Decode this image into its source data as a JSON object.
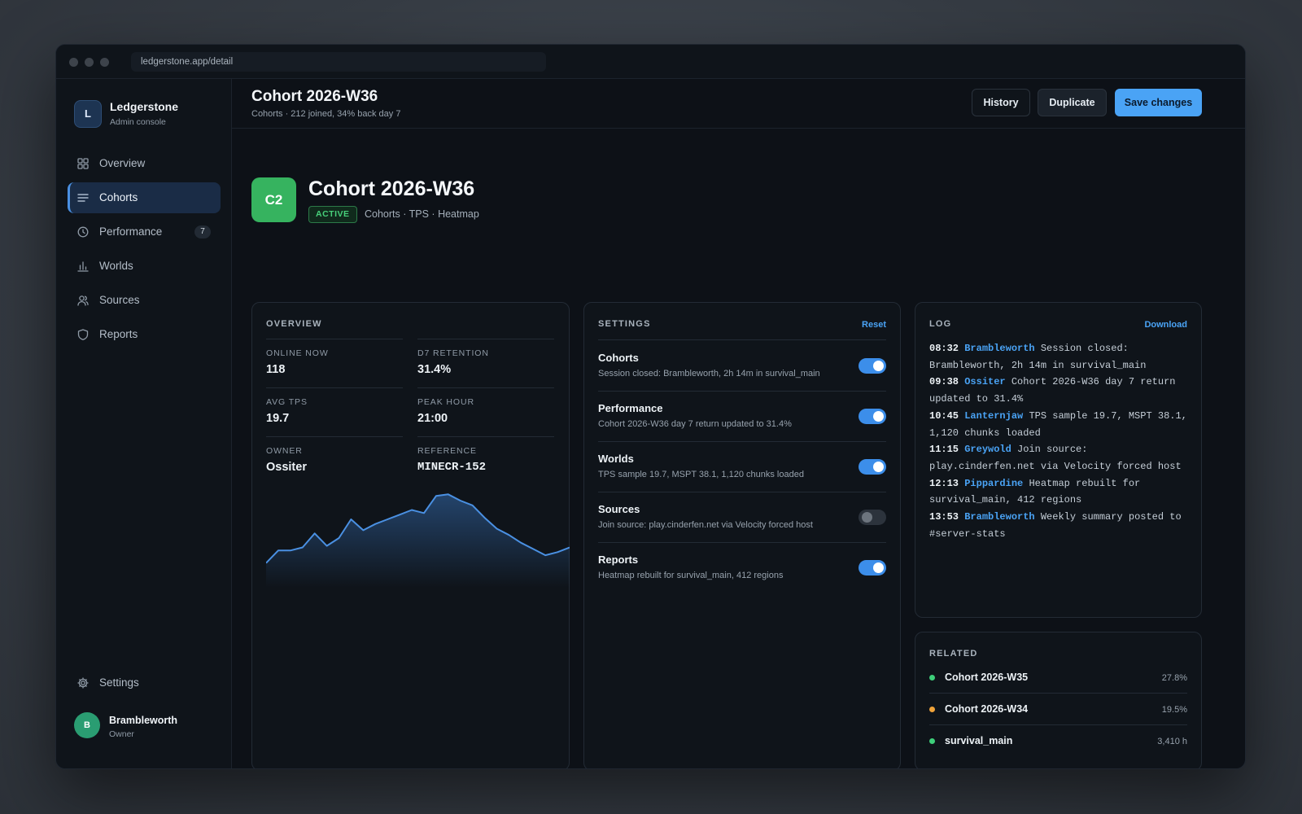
{
  "browser": {
    "url": "ledgerstone.app/detail"
  },
  "brand": {
    "logo_letter": "L",
    "name": "Ledgerstone",
    "subtitle": "Admin console"
  },
  "nav": {
    "items": [
      {
        "label": "Overview",
        "icon": "grid-icon"
      },
      {
        "label": "Cohorts",
        "icon": "list-icon",
        "active": true
      },
      {
        "label": "Performance",
        "icon": "clock-icon",
        "badge": "7"
      },
      {
        "label": "Worlds",
        "icon": "bar-chart-icon"
      },
      {
        "label": "Sources",
        "icon": "users-icon"
      },
      {
        "label": "Reports",
        "icon": "shield-icon"
      }
    ],
    "settings_label": "Settings"
  },
  "user": {
    "initial": "B",
    "name": "Brambleworth",
    "role": "Owner"
  },
  "header": {
    "title": "Cohort 2026-W36",
    "subtitle": "Cohorts · 212 joined, 34% back day 7",
    "history_label": "History",
    "duplicate_label": "Duplicate",
    "save_label": "Save changes"
  },
  "hero": {
    "icon_text": "C2",
    "title": "Cohort 2026-W36",
    "status": "ACTIVE",
    "meta": "Cohorts · TPS · Heatmap"
  },
  "overview": {
    "heading": "OVERVIEW",
    "stats": [
      {
        "label": "ONLINE NOW",
        "value": "118"
      },
      {
        "label": "D7 RETENTION",
        "value": "31.4%"
      },
      {
        "label": "AVG TPS",
        "value": "19.7"
      },
      {
        "label": "PEAK HOUR",
        "value": "21:00"
      },
      {
        "label": "OWNER",
        "value": "Ossiter"
      },
      {
        "label": "REFERENCE",
        "value": "MINECR-152"
      }
    ]
  },
  "chart_data": {
    "type": "area",
    "values": [
      8,
      16,
      16,
      18,
      27,
      19,
      24,
      36,
      29,
      33,
      36,
      39,
      42,
      40,
      51,
      52,
      48,
      45,
      37,
      30,
      26,
      21,
      17,
      13,
      15,
      18
    ],
    "ylim": [
      0,
      60
    ],
    "color": "#4a90e2"
  },
  "settings": {
    "heading": "SETTINGS",
    "reset_label": "Reset",
    "rows": [
      {
        "title": "Cohorts",
        "desc": "Session closed: Brambleworth, 2h 14m in survival_main",
        "on": true
      },
      {
        "title": "Performance",
        "desc": "Cohort 2026-W36 day 7 return updated to 31.4%",
        "on": true
      },
      {
        "title": "Worlds",
        "desc": "TPS sample 19.7, MSPT 38.1, 1,120 chunks loaded",
        "on": true
      },
      {
        "title": "Sources",
        "desc": "Join source: play.cinderfen.net via Velocity forced host",
        "on": false
      },
      {
        "title": "Reports",
        "desc": "Heatmap rebuilt for survival_main, 412 regions",
        "on": true
      }
    ]
  },
  "log": {
    "heading": "LOG",
    "download_label": "Download",
    "entries": [
      {
        "time": "08:32",
        "user": "Brambleworth",
        "text": "Session closed: Brambleworth, 2h 14m in survival_main"
      },
      {
        "time": "09:38",
        "user": "Ossiter",
        "text": "Cohort 2026-W36 day 7 return updated to 31.4%"
      },
      {
        "time": "10:45",
        "user": "Lanternjaw",
        "text": "TPS sample 19.7, MSPT 38.1, 1,120 chunks loaded"
      },
      {
        "time": "11:15",
        "user": "Greywold",
        "text": "Join source: play.cinderfen.net via Velocity forced host"
      },
      {
        "time": "12:13",
        "user": "Pippardine",
        "text": "Heatmap rebuilt for survival_main, 412 regions"
      },
      {
        "time": "13:53",
        "user": "Brambleworth",
        "text": "Weekly summary posted to #server-stats"
      }
    ]
  },
  "related": {
    "heading": "RELATED",
    "items": [
      {
        "name": "Cohort 2026-W35",
        "value": "27.8%",
        "color": "#3ecf7a"
      },
      {
        "name": "Cohort 2026-W34",
        "value": "19.5%",
        "color": "#f0a33a"
      },
      {
        "name": "survival_main",
        "value": "3,410 h",
        "color": "#3ecf7a"
      }
    ]
  }
}
